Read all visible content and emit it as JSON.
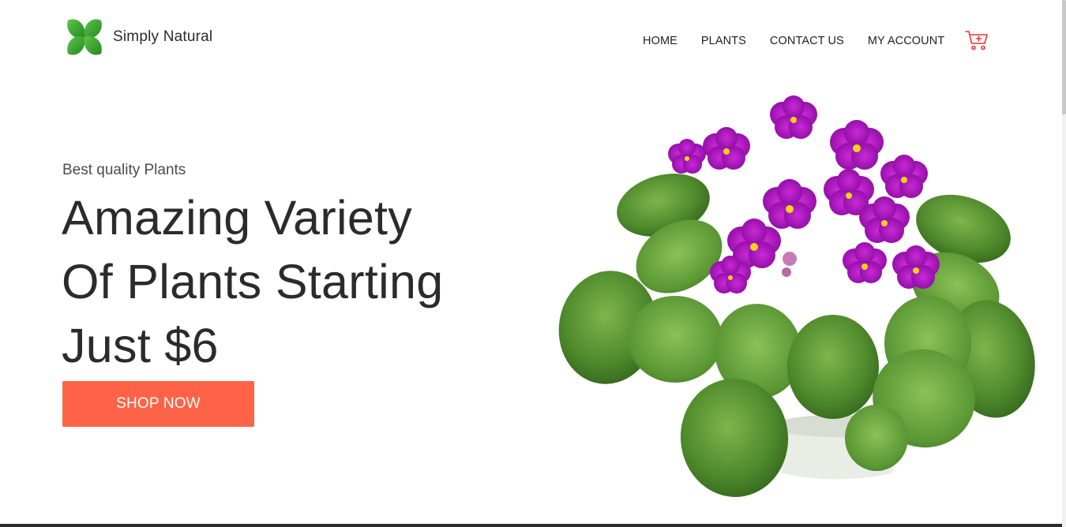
{
  "brand": {
    "name": "Simply Natural",
    "logo_icon": "leaf-x-logo-icon",
    "logo_color": "#3aa935"
  },
  "nav": {
    "items": [
      {
        "label": "HOME"
      },
      {
        "label": "PLANTS"
      },
      {
        "label": "CONTACT US"
      },
      {
        "label": "MY ACCOUNT"
      }
    ],
    "cart_icon": "shopping-cart-icon",
    "cart_color": "#e8362f"
  },
  "hero": {
    "eyebrow": "Best quality Plants",
    "headline_lines": [
      "Amazing Variety",
      "Of Plants Starting",
      "Just $6"
    ],
    "cta_label": "SHOP NOW",
    "cta_color": "#ff6347",
    "image_icon": "african-violet-plant-image"
  }
}
